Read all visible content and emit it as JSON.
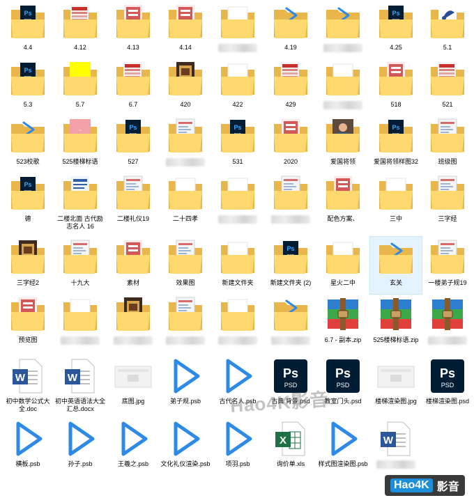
{
  "colors": {
    "folder_back": "#e8b64b",
    "folder_front": "#ffd86e",
    "ps_bg": "#001d34",
    "ps_text": "#31a8ff",
    "play_blue": "#2d8ae6",
    "zip_blue": "#2f7fd1",
    "zip_green": "#3da84a",
    "zip_red": "#e0403c",
    "excel_green": "#1e7145",
    "word_blue": "#2b579a"
  },
  "items": [
    {
      "label": "4.4",
      "type": "folder",
      "preview": "ps"
    },
    {
      "label": "4.12",
      "type": "folder",
      "preview": "ps-red"
    },
    {
      "label": "4.13",
      "type": "folder",
      "preview": "red-doc"
    },
    {
      "label": "4.14",
      "type": "folder",
      "preview": "red-doc"
    },
    {
      "label": "",
      "type": "folder",
      "preview": "plain",
      "blurred": true
    },
    {
      "label": "4.19",
      "type": "folder",
      "preview": "play"
    },
    {
      "label": "",
      "type": "folder",
      "preview": "play",
      "blurred": true
    },
    {
      "label": "4.25",
      "type": "folder",
      "preview": "ps"
    },
    {
      "label": "5.1",
      "type": "folder",
      "preview": "blue-fan"
    },
    {
      "label": "5.3",
      "type": "folder",
      "preview": "ps"
    },
    {
      "label": "5.7",
      "type": "folder",
      "preview": "yellow"
    },
    {
      "label": "6.7",
      "type": "folder",
      "preview": "ps-red"
    },
    {
      "label": "420",
      "type": "folder",
      "preview": "dark-doc"
    },
    {
      "label": "422",
      "type": "folder",
      "preview": "plain"
    },
    {
      "label": "429",
      "type": "folder",
      "preview": "ps-red"
    },
    {
      "label": "",
      "type": "folder",
      "preview": "plain",
      "blurred": true
    },
    {
      "label": "518",
      "type": "folder",
      "preview": "red-doc"
    },
    {
      "label": "521",
      "type": "folder",
      "preview": "ps-red"
    },
    {
      "label": "523校歌",
      "type": "folder",
      "preview": "play"
    },
    {
      "label": "525楼梯标语",
      "type": "folder",
      "preview": "pink"
    },
    {
      "label": "527",
      "type": "folder",
      "preview": "ps"
    },
    {
      "label": "",
      "type": "folder",
      "preview": "doc",
      "blurred": true
    },
    {
      "label": "531",
      "type": "folder",
      "preview": "ps"
    },
    {
      "label": "2020",
      "type": "folder",
      "preview": "red-doc"
    },
    {
      "label": "爱国将领",
      "type": "folder",
      "preview": "portrait"
    },
    {
      "label": "爱国将领样图32",
      "type": "folder",
      "preview": "ps"
    },
    {
      "label": "班级图",
      "type": "folder",
      "preview": "doc"
    },
    {
      "label": "德",
      "type": "folder",
      "preview": "ps"
    },
    {
      "label": "二楼北面 古代励志名人 16",
      "type": "folder",
      "preview": "blue-doc"
    },
    {
      "label": "二楼礼仪19",
      "type": "folder",
      "preview": "doc"
    },
    {
      "label": "二十四孝",
      "type": "folder",
      "preview": "plain"
    },
    {
      "label": "",
      "type": "folder",
      "preview": "plain",
      "blurred": true
    },
    {
      "label": "",
      "type": "folder",
      "preview": "doc",
      "blurred": true
    },
    {
      "label": "配色方案、",
      "type": "folder",
      "preview": "red-doc"
    },
    {
      "label": "三中",
      "type": "folder",
      "preview": "plain"
    },
    {
      "label": "三字经",
      "type": "folder",
      "preview": "doc"
    },
    {
      "label": "三字经2",
      "type": "folder",
      "preview": "dark-doc"
    },
    {
      "label": "十九大",
      "type": "folder",
      "preview": "doc"
    },
    {
      "label": "素材",
      "type": "folder",
      "preview": "red-doc"
    },
    {
      "label": "效果图",
      "type": "folder",
      "preview": "doc"
    },
    {
      "label": "新建文件夹",
      "type": "folder",
      "preview": "plain"
    },
    {
      "label": "新建文件夹 (2)",
      "type": "folder",
      "preview": "ps"
    },
    {
      "label": "星火二中",
      "type": "folder",
      "preview": "plain"
    },
    {
      "label": "玄关",
      "type": "folder",
      "preview": "play",
      "selected": true
    },
    {
      "label": "一楼弟子规19",
      "type": "folder",
      "preview": "doc"
    },
    {
      "label": "预览图",
      "type": "folder",
      "preview": "red-doc"
    },
    {
      "label": "",
      "type": "folder",
      "preview": "plain",
      "blurred": true
    },
    {
      "label": "",
      "type": "folder",
      "preview": "dark-doc",
      "blurred": true
    },
    {
      "label": "",
      "type": "folder",
      "preview": "doc",
      "blurred": true
    },
    {
      "label": "",
      "type": "folder",
      "preview": "plain",
      "blurred": true
    },
    {
      "label": "",
      "type": "folder",
      "preview": "play",
      "blurred": true
    },
    {
      "label": "6.7 - 副本.zip",
      "type": "zip"
    },
    {
      "label": "525楼梯标语.zip",
      "type": "zip"
    },
    {
      "label": "",
      "type": "zip",
      "blurred": true
    },
    {
      "label": "初中数学公式大全.doc",
      "type": "word"
    },
    {
      "label": "初中英语语法大全汇总.docx",
      "type": "word"
    },
    {
      "label": "底图.jpg",
      "type": "image"
    },
    {
      "label": "弟子规.psb",
      "type": "play"
    },
    {
      "label": "古代名人.psb",
      "type": "play"
    },
    {
      "label": "古典 背景.psd",
      "type": "ps"
    },
    {
      "label": "教室门头.psd",
      "type": "ps"
    },
    {
      "label": "楼梯渲染图.jpg",
      "type": "image"
    },
    {
      "label": "楼梯渲染图.psd",
      "type": "ps"
    },
    {
      "label": "横板.psb",
      "type": "play"
    },
    {
      "label": "孙子.psb",
      "type": "play"
    },
    {
      "label": "王羲之.psb",
      "type": "play"
    },
    {
      "label": "文化礼仪渲染.psb",
      "type": "play"
    },
    {
      "label": "项羽.psb",
      "type": "play"
    },
    {
      "label": "询价单.xls",
      "type": "excel"
    },
    {
      "label": "样式图渲染图.psb",
      "type": "play"
    },
    {
      "label": "",
      "type": "word",
      "blurred": true
    }
  ],
  "watermark": "Hao4K影音",
  "logo": {
    "box": "Hao4K",
    "text": "影音"
  }
}
